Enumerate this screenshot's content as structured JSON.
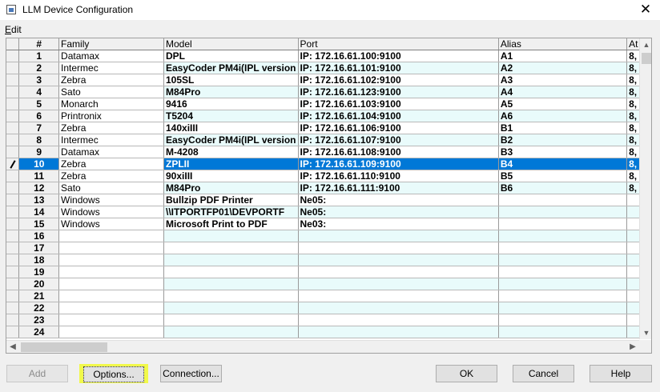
{
  "window": {
    "title": "LLM Device Configuration",
    "close_glyph": "✕"
  },
  "menu": {
    "edit_first": "E",
    "edit_rest": "dit"
  },
  "grid": {
    "headers": {
      "num": "#",
      "family": "Family",
      "model": "Model",
      "port": "Port",
      "alias": "Alias",
      "at": "At"
    },
    "rows": [
      {
        "num": "1",
        "family": "Datamax",
        "model": "DPL",
        "port": "IP: 172.16.61.100:9100",
        "alias": "A1",
        "at": "8,"
      },
      {
        "num": "2",
        "family": "Intermec",
        "model": "EasyCoder PM4i(IPL version",
        "port": "IP: 172.16.61.101:9100",
        "alias": "A2",
        "at": "8,"
      },
      {
        "num": "3",
        "family": "Zebra",
        "model": "105SL",
        "port": "IP: 172.16.61.102:9100",
        "alias": "A3",
        "at": "8,"
      },
      {
        "num": "4",
        "family": "Sato",
        "model": "M84Pro",
        "port": "IP: 172.16.61.123:9100",
        "alias": "A4",
        "at": "8,"
      },
      {
        "num": "5",
        "family": "Monarch",
        "model": "9416",
        "port": "IP: 172.16.61.103:9100",
        "alias": "A5",
        "at": "8,"
      },
      {
        "num": "6",
        "family": "Printronix",
        "model": "T5204",
        "port": "IP: 172.16.61.104:9100",
        "alias": "A6",
        "at": "8,"
      },
      {
        "num": "7",
        "family": "Zebra",
        "model": "140xiIII",
        "port": "IP: 172.16.61.106:9100",
        "alias": "B1",
        "at": "8,"
      },
      {
        "num": "8",
        "family": "Intermec",
        "model": "EasyCoder PM4i(IPL version",
        "port": "IP: 172.16.61.107:9100",
        "alias": "B2",
        "at": "8,"
      },
      {
        "num": "9",
        "family": "Datamax",
        "model": "M-4208",
        "port": "IP: 172.16.61.108:9100",
        "alias": "B3",
        "at": "8,"
      },
      {
        "num": "10",
        "family": "Zebra",
        "model": "ZPLII",
        "port": "IP: 172.16.61.109:9100",
        "alias": "B4",
        "at": "8,"
      },
      {
        "num": "11",
        "family": "Zebra",
        "model": "90xiIII",
        "port": "IP: 172.16.61.110:9100",
        "alias": "B5",
        "at": "8,"
      },
      {
        "num": "12",
        "family": "Sato",
        "model": "M84Pro",
        "port": "IP: 172.16.61.111:9100",
        "alias": "B6",
        "at": "8,"
      },
      {
        "num": "13",
        "family": "Windows",
        "model": "Bullzip PDF Printer",
        "port": "Ne05:",
        "alias": "",
        "at": ""
      },
      {
        "num": "14",
        "family": "Windows",
        "model": "\\\\ITPORTFP01\\DEVPORTF",
        "port": "Ne05:",
        "alias": "",
        "at": ""
      },
      {
        "num": "15",
        "family": "Windows",
        "model": "Microsoft Print to PDF",
        "port": "Ne03:",
        "alias": "",
        "at": ""
      },
      {
        "num": "16",
        "family": "",
        "model": "",
        "port": "",
        "alias": "",
        "at": ""
      },
      {
        "num": "17",
        "family": "",
        "model": "",
        "port": "",
        "alias": "",
        "at": ""
      },
      {
        "num": "18",
        "family": "",
        "model": "",
        "port": "",
        "alias": "",
        "at": ""
      },
      {
        "num": "19",
        "family": "",
        "model": "",
        "port": "",
        "alias": "",
        "at": ""
      },
      {
        "num": "20",
        "family": "",
        "model": "",
        "port": "",
        "alias": "",
        "at": ""
      },
      {
        "num": "21",
        "family": "",
        "model": "",
        "port": "",
        "alias": "",
        "at": ""
      },
      {
        "num": "22",
        "family": "",
        "model": "",
        "port": "",
        "alias": "",
        "at": ""
      },
      {
        "num": "23",
        "family": "",
        "model": "",
        "port": "",
        "alias": "",
        "at": ""
      },
      {
        "num": "24",
        "family": "",
        "model": "",
        "port": "",
        "alias": "",
        "at": ""
      }
    ],
    "selected_row": "10"
  },
  "buttons": {
    "add": "Add",
    "options": "Options...",
    "connection": "Connection...",
    "ok": "OK",
    "cancel": "Cancel",
    "help": "Help"
  },
  "colors": {
    "selection": "#0078d7",
    "alt_row": "#e9fbfb",
    "highlight": "#f1f94a"
  }
}
